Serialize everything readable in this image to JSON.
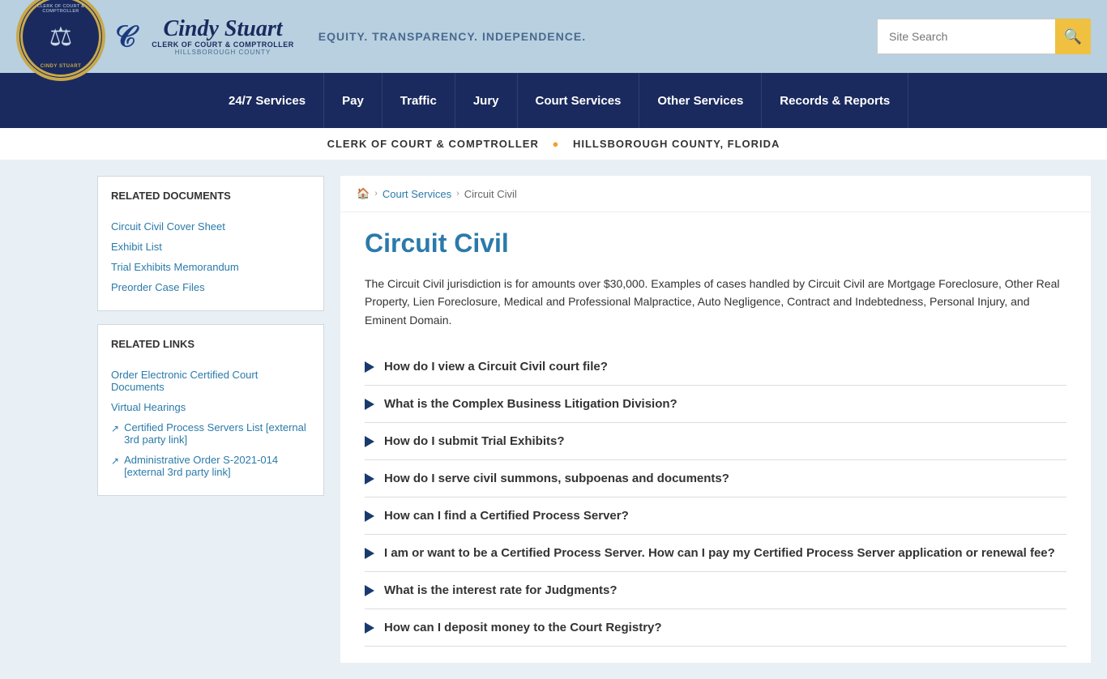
{
  "header": {
    "logo_text": "⚖",
    "cindy_name": "Cindy Stuart",
    "cindy_subtitle": "Clerk of Court & Comptroller",
    "cindy_county": "Hillsborough County",
    "tagline": "EQUITY. TRANSPARENCY. INDEPENDENCE.",
    "search_placeholder": "Site Search"
  },
  "nav": {
    "items": [
      {
        "label": "24/7 Services"
      },
      {
        "label": "Pay"
      },
      {
        "label": "Traffic"
      },
      {
        "label": "Jury"
      },
      {
        "label": "Court Services"
      },
      {
        "label": "Other Services"
      },
      {
        "label": "Records & Reports"
      }
    ]
  },
  "sub_header": {
    "clerk": "CLERK OF COURT & COMPTROLLER",
    "county": "HILLSBOROUGH COUNTY, FLORIDA"
  },
  "breadcrumb": {
    "home": "🏠",
    "parent": "Court Services",
    "current": "Circuit Civil"
  },
  "page": {
    "title": "Circuit Civil",
    "description": "The Circuit Civil jurisdiction is for amounts over $30,000. Examples of cases handled by Circuit Civil are Mortgage Foreclosure, Other Real Property, Lien Foreclosure, Medical and Professional Malpractice, Auto Negligence, Contract and Indebtedness, Personal Injury, and Eminent Domain.",
    "faqs": [
      {
        "question": "How do I view a Circuit Civil court file?"
      },
      {
        "question": "What is the Complex Business Litigation Division?"
      },
      {
        "question": "How do I submit Trial Exhibits?"
      },
      {
        "question": "How do I serve civil summons, subpoenas and documents?"
      },
      {
        "question": "How can I find a Certified Process Server?"
      },
      {
        "question": "I am or want to be a Certified Process Server. How can I pay my Certified Process Server application or renewal fee?"
      },
      {
        "question": "What is the interest rate for Judgments?"
      },
      {
        "question": "How can I deposit money to the Court Registry?"
      }
    ]
  },
  "sidebar": {
    "related_documents_title": "RELATED DOCUMENTS",
    "documents": [
      {
        "label": "Circuit Civil Cover Sheet"
      },
      {
        "label": "Exhibit List"
      },
      {
        "label": "Trial Exhibits Memorandum"
      },
      {
        "label": "Preorder Case Files"
      }
    ],
    "related_links_title": "RELATED LINKS",
    "links": [
      {
        "label": "Order Electronic Certified Court Documents",
        "external": false
      },
      {
        "label": "Virtual Hearings",
        "external": false
      },
      {
        "label": "Certified Process Servers List [external 3rd party link]",
        "external": true
      },
      {
        "label": "Administrative Order S-2021-014 [external 3rd party link]",
        "external": true
      }
    ]
  }
}
